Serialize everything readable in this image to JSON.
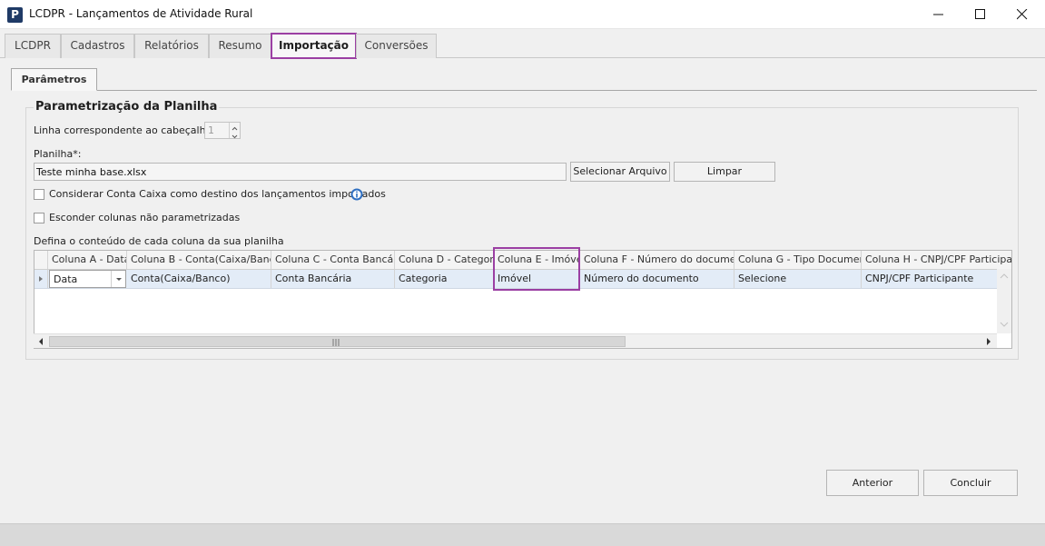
{
  "window": {
    "title": "LCDPR - Lançamentos de Atividade Rural",
    "app_icon_letter": "P"
  },
  "main_tabs": [
    "LCDPR",
    "Cadastros",
    "Relatórios",
    "Resumo",
    "Importação",
    "Conversões"
  ],
  "active_tab": "Importação",
  "sub_tab": "Parâmetros",
  "group": {
    "title": "Parametrização da Planilha",
    "header_line_label": "Linha correspondente ao cabeçalho*",
    "header_line_value": "1",
    "sheet_label": "Planilha*:",
    "sheet_value": "Teste minha base.xlsx",
    "select_file_button": "Selecionar Arquivo",
    "clear_button": "Limpar",
    "checkbox_cash_account": "Considerar Conta Caixa como destino dos lançamentos importados",
    "checkbox_hide_columns": "Esconder colunas não parametrizadas",
    "grid_caption": "Defina o conteúdo de cada coluna da sua planilha"
  },
  "grid": {
    "headers": [
      "Coluna A - Data",
      "Coluna B - Conta(Caixa/Banco)",
      "Coluna C - Conta Bancária",
      "Coluna D - Categoria",
      "Coluna E - Imóvel",
      "Coluna F - Número do documento",
      "Coluna G - Tipo Documento",
      "Coluna H - CNPJ/CPF Participante"
    ],
    "row": [
      "Data",
      "Conta(Caixa/Banco)",
      "Conta Bancária",
      "Categoria",
      "Imóvel",
      "Número do documento",
      "Selecione",
      "CNPJ/CPF Participante"
    ]
  },
  "footer": {
    "back_button": "Anterior",
    "finish_button": "Concluir"
  },
  "colors": {
    "highlight": "#9b3fa3",
    "selected_row": "#e3ecf7",
    "app_icon": "#1f3a66"
  }
}
